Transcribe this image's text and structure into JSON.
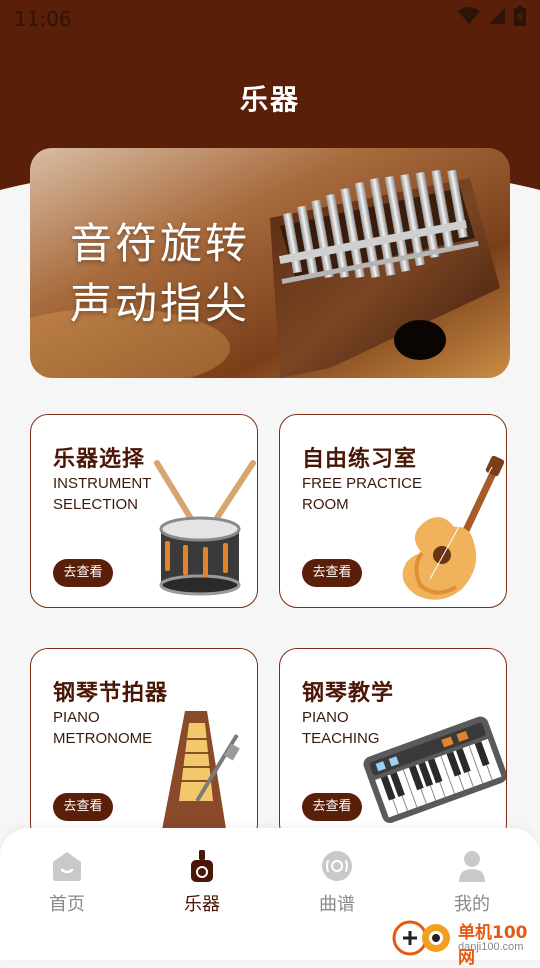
{
  "status": {
    "time": "11:06"
  },
  "page": {
    "title": "乐器"
  },
  "banner": {
    "line1": "音符旋转",
    "line2": "声动指尖"
  },
  "cards": [
    {
      "title": "乐器选择",
      "sub1": "INSTRUMENT",
      "sub2": "SELECTION",
      "button": "去查看",
      "icon": "drum-icon"
    },
    {
      "title": "自由练习室",
      "sub1": "FREE PRACTICE",
      "sub2": "ROOM",
      "button": "去查看",
      "icon": "guitar-icon"
    },
    {
      "title": "钢琴节拍器",
      "sub1": "PIANO",
      "sub2": "METRONOME",
      "button": "去查看",
      "icon": "metronome-icon"
    },
    {
      "title": "钢琴教学",
      "sub1": "PIANO",
      "sub2": "TEACHING",
      "button": "去查看",
      "icon": "keyboard-icon"
    }
  ],
  "tabs": [
    {
      "label": "首页",
      "icon": "home-icon",
      "active": false
    },
    {
      "label": "乐器",
      "icon": "instrument-icon",
      "active": true
    },
    {
      "label": "曲谱",
      "icon": "music-score-icon",
      "active": false
    },
    {
      "label": "我的",
      "icon": "profile-icon",
      "active": false
    }
  ],
  "watermark": {
    "name": "单机100网",
    "url": "danji100.com"
  },
  "colors": {
    "primary": "#5a1f09",
    "border": "#7a2f12",
    "background": "#f6f6f6"
  }
}
